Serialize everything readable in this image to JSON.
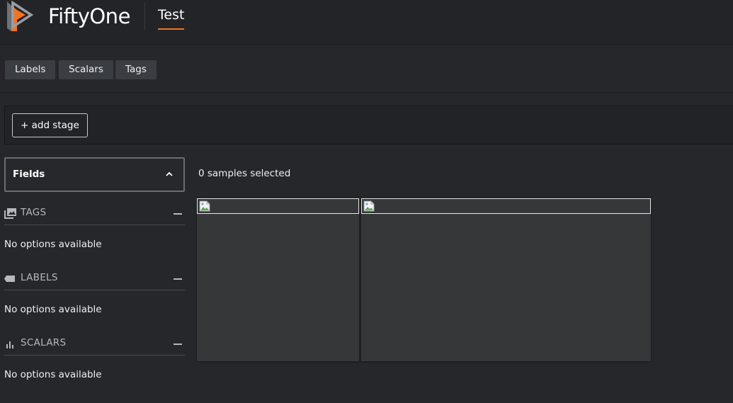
{
  "header": {
    "brand": "FiftyOne",
    "dataset_name": "Test",
    "logo_icon": "fiftyone-logo-icon",
    "accent_color": "#f37321"
  },
  "tabs": [
    {
      "label": "Labels"
    },
    {
      "label": "Scalars"
    },
    {
      "label": "Tags"
    }
  ],
  "view_bar": {
    "add_stage_label": "+ add stage"
  },
  "sidebar": {
    "fields_label": "Fields",
    "groups": [
      {
        "label": "TAGS",
        "icon": "image-icon",
        "empty_text": "No options available"
      },
      {
        "label": "LABELS",
        "icon": "label-tag-icon",
        "empty_text": "No options available"
      },
      {
        "label": "SCALARS",
        "icon": "bar-chart-icon",
        "empty_text": "No options available"
      }
    ]
  },
  "main": {
    "selected_text": "0 samples selected",
    "samples": [
      {
        "image_icon": "broken-image-icon"
      },
      {
        "image_icon": "broken-image-icon"
      }
    ]
  }
}
